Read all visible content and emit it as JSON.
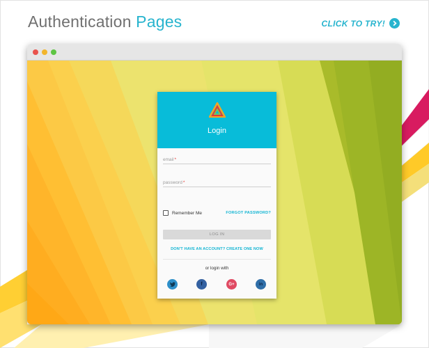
{
  "header": {
    "title_part1": "Authentication",
    "title_part2": "Pages",
    "cta_label": "CLICK TO TRY!"
  },
  "window": {
    "controls": [
      "close",
      "minimize",
      "maximize"
    ],
    "control_colors": [
      "#e9534d",
      "#f2b52c",
      "#5ec543"
    ]
  },
  "login_card": {
    "title": "Login",
    "email_placeholder": "email",
    "password_placeholder": "password",
    "required_marker": "*",
    "remember_label": "Remember Me",
    "forgot_label": "FORGOT PASSWORD?",
    "login_button": "LOG IN",
    "signup_link": "DON'T HAVE AN ACCOUNT? CREATE ONE NOW",
    "social_label": "or login with",
    "social": [
      {
        "name": "twitter-icon",
        "glyph": "t",
        "color": "#2d8fc9"
      },
      {
        "name": "facebook-icon",
        "glyph": "f",
        "color": "#3461a1"
      },
      {
        "name": "google-plus-icon",
        "glyph": "G+",
        "color": "#e04a63"
      },
      {
        "name": "linkedin-icon",
        "glyph": "in",
        "color": "#2f6ea8"
      }
    ]
  },
  "colors": {
    "accent": "#27b4ce",
    "card_header": "#08bcd9",
    "title_gray": "#707070"
  }
}
